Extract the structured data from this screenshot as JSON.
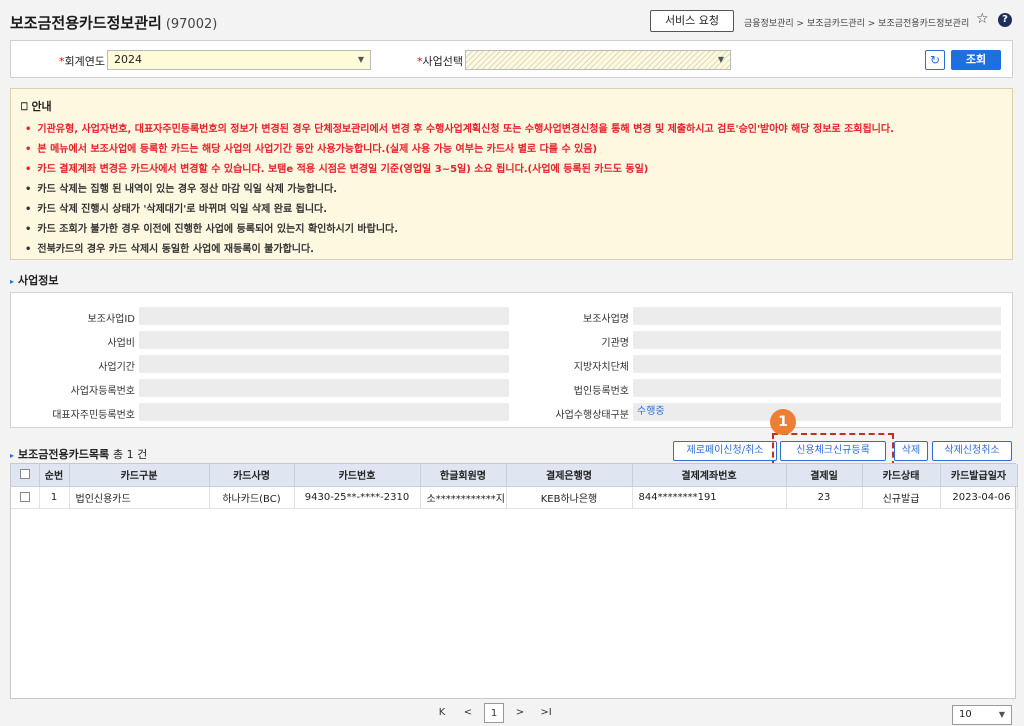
{
  "header": {
    "title": "보조금전용카드정보관리",
    "code": "(97002)",
    "service_request": "서비스 요청",
    "breadcrumb": "금융정보관리 > 보조금카드관리 > 보조금전용카드정보관리"
  },
  "search": {
    "year_label": "회계연도",
    "year_value": "2024",
    "business_label": "사업선택",
    "business_value": "",
    "query_label": "조회"
  },
  "notice": {
    "title": "안내",
    "items": [
      {
        "text": "기관유형, 사업자번호, 대표자주민등록번호의 정보가 변경된 경우 단체정보관리에서 변경 후 수행사업계획신청 또는 수행사업변경신청을 통해 변경 및 제출하시고 검토'승인'받아야 해당 정보로 조회됩니다.",
        "red": true
      },
      {
        "text": "본 메뉴에서 보조사업에 등록한 카드는 해당 사업의 사업기간 동안 사용가능합니다.(실제 사용 가능 여부는 카드사 별로 다를 수 있음)",
        "red": true
      },
      {
        "text": "카드 결제계좌 변경은 카드사에서 변경할 수 있습니다. 보탬e 적용 시점은 변경일 기준(영업일 3~5일) 소요 됩니다.(사업에 등록된 카드도 동일)",
        "red": true
      },
      {
        "text": "카드 삭제는 집행 된 내역이 있는 경우 정산 마감 익일 삭제 가능합니다.",
        "red": false
      },
      {
        "text": "카드 삭제 진행시 상태가 '삭제대기'로 바뀌며 익일 삭제 완료 됩니다.",
        "red": false
      },
      {
        "text": "카드 조회가 불가한 경우 이전에 진행한 사업에 등록되어 있는지 확인하시기 바랍니다.",
        "red": false
      },
      {
        "text": "전북카드의 경우 카드 삭제시 동일한 사업에 재등록이 불가합니다.",
        "red": false
      }
    ]
  },
  "business_info": {
    "section_title": "사업정보",
    "fields": {
      "subsidy_id_label": "보조사업ID",
      "subsidy_name_label": "보조사업명",
      "budget_label": "사업비",
      "agency_label": "기관명",
      "period_label": "사업기간",
      "local_gov_label": "지방자치단체",
      "biz_reg_label": "사업자등록번호",
      "corp_reg_label": "법인등록번호",
      "rep_id_label": "대표자주민등록번호",
      "status_label": "사업수행상태구분",
      "status_value": "수행중"
    }
  },
  "card_list": {
    "section_title": "보조금전용카드목록",
    "count_text": "총 1 건",
    "buttons": {
      "zeropay": "제로페이신청/취소",
      "register": "신용체크신규등록",
      "delete": "삭제",
      "cancel_delete": "삭제신청취소"
    },
    "badge": "1",
    "columns": [
      "",
      "순번",
      "카드구분",
      "카드사명",
      "카드번호",
      "한글회원명",
      "결제은행명",
      "결제계좌번호",
      "결제일",
      "카드상태",
      "카드발급일자"
    ],
    "rows": [
      {
        "no": "1",
        "type": "법인신용카드",
        "company": "하나카드(BC)",
        "card_no": "9430-25**-****-2310",
        "member": "소************지",
        "bank": "KEB하나은행",
        "account": "844********191",
        "pay_day": "23",
        "status": "신규발급",
        "issued": "2023-04-06"
      }
    ]
  },
  "pagination": {
    "first": "K",
    "prev": "<",
    "current": "1",
    "next": ">",
    "last": ">I",
    "page_size": "10"
  },
  "colors": {
    "accent": "#1e6fe0",
    "warning": "#e8202a",
    "badge": "#ef7d32"
  }
}
